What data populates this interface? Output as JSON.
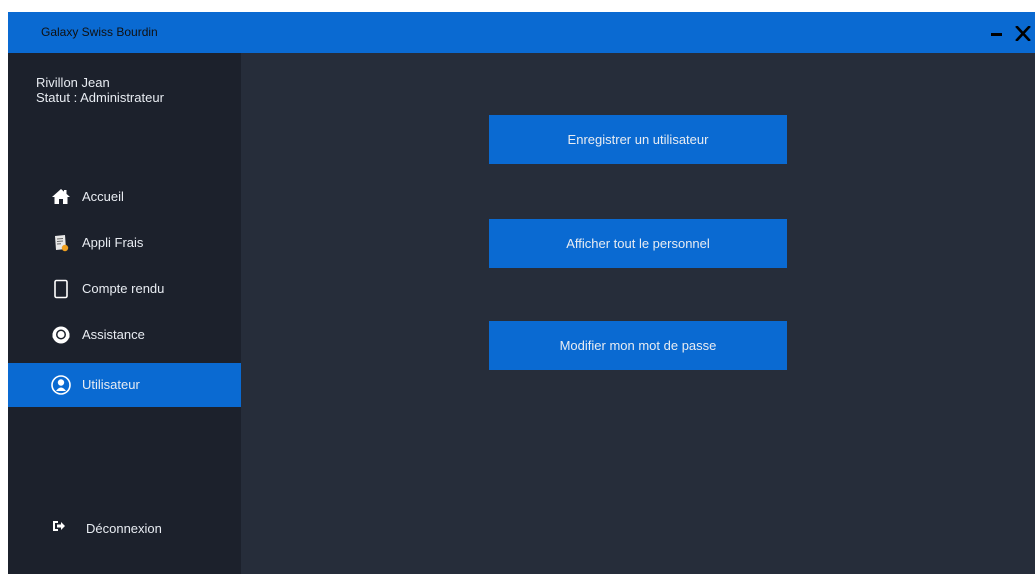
{
  "window": {
    "title": "Galaxy Swiss Bourdin"
  },
  "user": {
    "name": "Rivillon Jean",
    "status": "Statut :  Administrateur"
  },
  "sidebar": {
    "items": [
      {
        "label": "Accueil",
        "icon": "home-icon"
      },
      {
        "label": "Appli Frais",
        "icon": "receipt-icon"
      },
      {
        "label": "Compte rendu",
        "icon": "tablet-icon"
      },
      {
        "label": "Assistance",
        "icon": "headset-icon"
      },
      {
        "label": "Utilisateur",
        "icon": "user-circle-icon",
        "active": true
      }
    ],
    "logout": {
      "label": "Déconnexion",
      "icon": "sign-out-icon"
    }
  },
  "main": {
    "buttons": [
      {
        "label": "Enregistrer un utilisateur"
      },
      {
        "label": "Afficher tout le personnel"
      },
      {
        "label": "Modifier mon mot de passe"
      }
    ]
  },
  "colors": {
    "accent": "#0a6ad2",
    "sidebar_bg": "#1c212c",
    "main_bg": "#262d3a"
  }
}
